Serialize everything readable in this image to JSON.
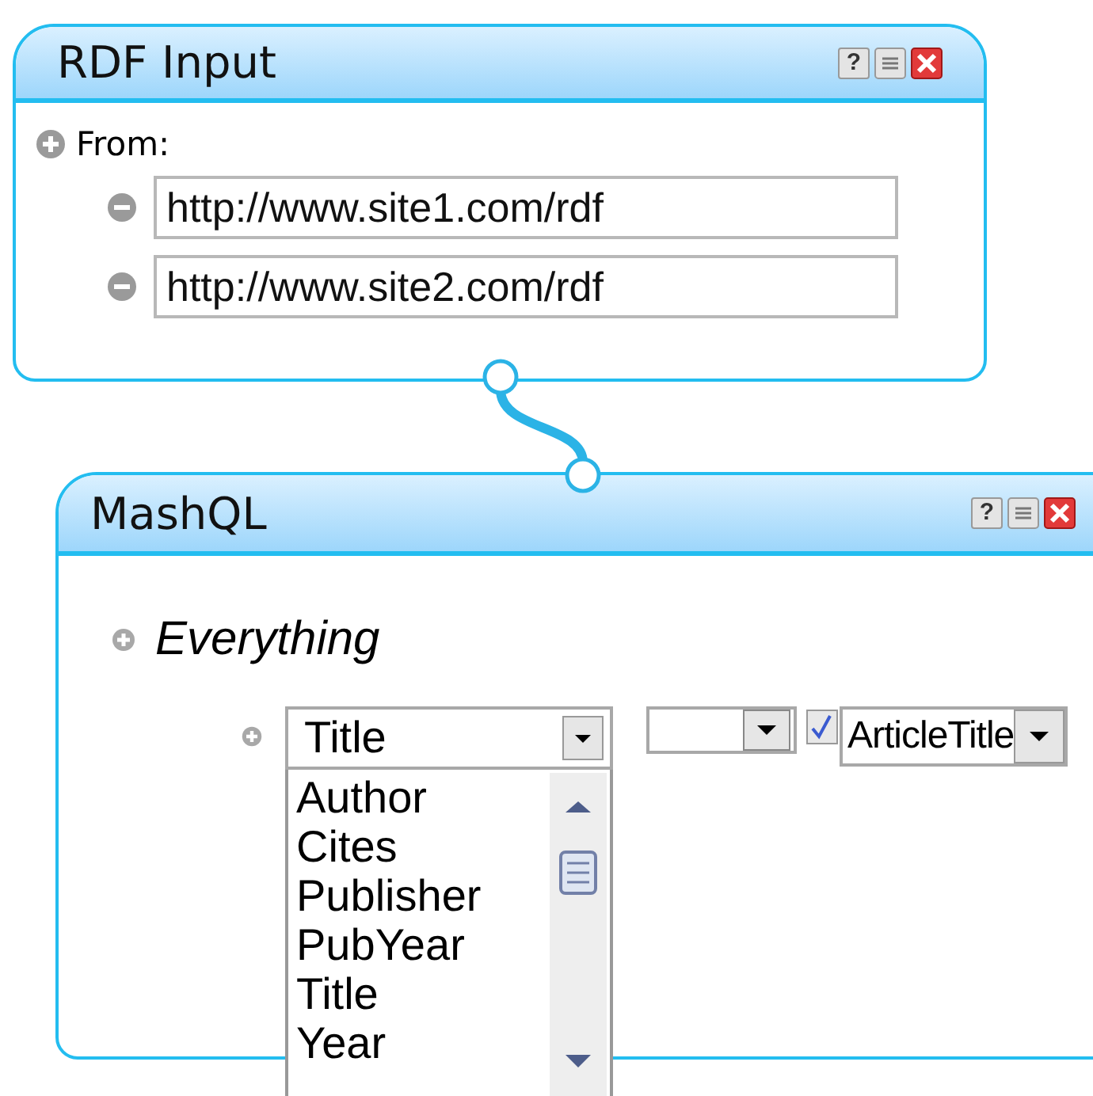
{
  "rdf_input": {
    "title": "RDF Input",
    "help_label": "?",
    "from_label": "From:",
    "sources": [
      {
        "value": "http://www.site1.com/rdf"
      },
      {
        "value": "http://www.site2.com/rdf"
      }
    ]
  },
  "mashql": {
    "title": "MashQL",
    "help_label": "?",
    "subject": "Everything",
    "property": {
      "value": "Title",
      "expanded": true,
      "options": [
        "Author",
        "Cites",
        "Publisher",
        "PubYear",
        "Title",
        "Year"
      ]
    },
    "checked": true,
    "object": {
      "value": "ArticleTitle"
    }
  }
}
